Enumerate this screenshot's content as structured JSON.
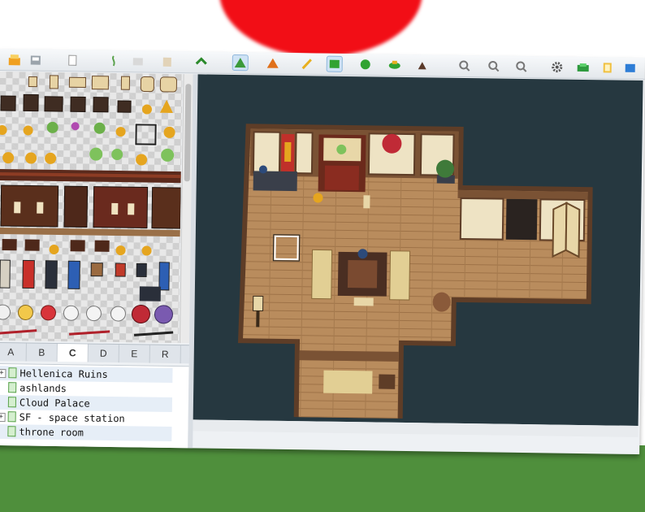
{
  "app": {
    "toolbar_icons": [
      "save-icon",
      "cut-icon",
      "copy-icon",
      "paste-icon",
      "undo-icon",
      "redo-icon",
      "layer-tool-icon",
      "event-tool-icon",
      "pencil-icon",
      "rectangle-icon",
      "ellipse-icon",
      "fill-icon",
      "shadow-pen-icon",
      "zoom-in-icon",
      "zoom-out-icon",
      "zoom-actual-icon",
      "settings-icon",
      "resource-icon",
      "script-icon",
      "play-icon"
    ]
  },
  "tileset": {
    "tabs": [
      {
        "label": "A"
      },
      {
        "label": "B"
      },
      {
        "label": "C",
        "active": true
      },
      {
        "label": "D"
      },
      {
        "label": "E"
      },
      {
        "label": "R"
      }
    ]
  },
  "map_tree": {
    "items": [
      {
        "label": "Hellenica Ruins",
        "expandable": true
      },
      {
        "label": "ashlands",
        "expandable": false
      },
      {
        "label": "Cloud Palace",
        "expandable": false
      },
      {
        "label": "SF - space station",
        "expandable": true
      },
      {
        "label": "throne room",
        "expandable": false
      }
    ]
  },
  "colors": {
    "canvas_bg": "#263840",
    "wood_floor": "#b98c5d",
    "wall_dark": "#5e3d27",
    "outer_green": "#4f8f3c",
    "red_blob": "#f20e16"
  }
}
